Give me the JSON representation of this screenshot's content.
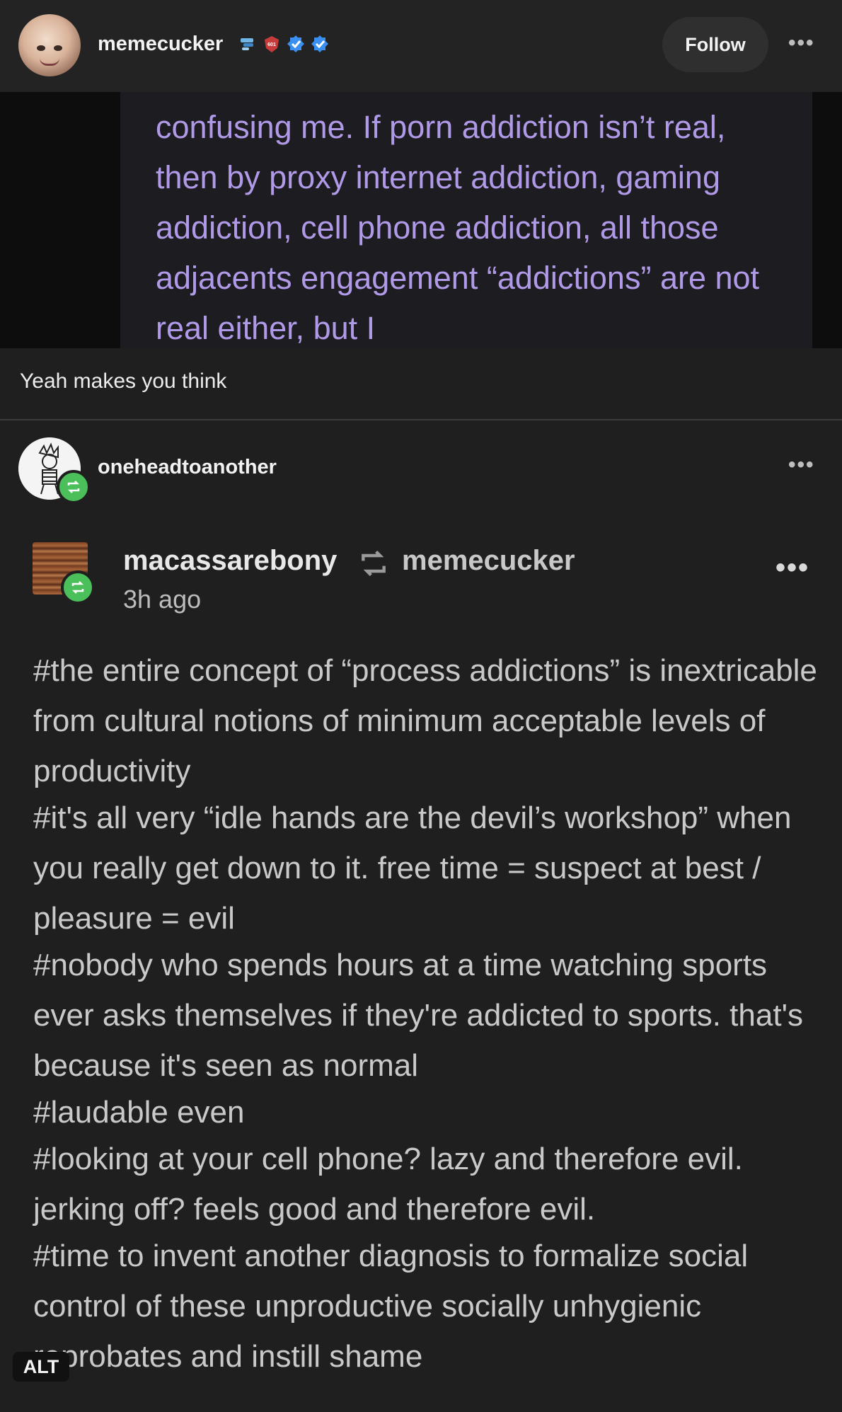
{
  "header": {
    "username": "memecucker",
    "follow_label": "Follow",
    "more_icon": "ellipsis-icon"
  },
  "embedded_screenshot": {
    "text": "confusing me. If porn addiction isn’t real, then by proxy internet addiction, gaming addiction, cell phone addiction, all those adjacents engagement “addictions” are not real either, but I"
  },
  "caption": "Yeah makes you think",
  "reblogger": {
    "username": "oneheadtoanother",
    "more_icon": "ellipsis-icon"
  },
  "inner_post": {
    "author": "macassarebony",
    "reblogged_from": "memecucker",
    "time": "3h ago",
    "tags": [
      "#the entire concept of “process addictions” is inextricable from cultural notions of minimum acceptable levels of productivity",
      "#it's all very “idle hands are the devil’s workshop” when you really get down to it. free time = suspect at best / pleasure = evil",
      "#nobody who spends hours at a time watching sports ever asks themselves if they're addicted to sports. that's because it's seen as normal",
      "#laudable even",
      "#looking at your cell phone? lazy and therefore evil. jerking off? feels good and therefore evil.",
      "#time to invent another diagnosis to formalize social control of these unproductive socially unhygienic reprobates and instill shame"
    ]
  },
  "alt_label": "ALT",
  "colors": {
    "background": "#1f1f1f",
    "header": "#232323",
    "screenshot_text": "#b09ae8",
    "verified_blue": "#3b8ff0",
    "reblog_green": "#4bbf5a"
  }
}
